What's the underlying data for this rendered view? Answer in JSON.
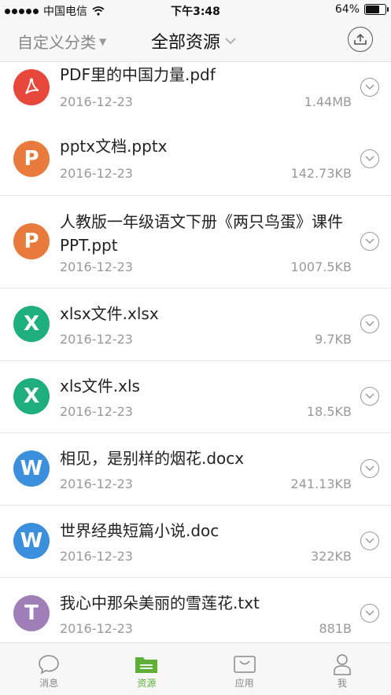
{
  "status_bar": {
    "carrier": "中国电信",
    "time": "下午3:48",
    "battery": "64%",
    "battery_level": 0.64
  },
  "header": {
    "left_label": "自定义分类",
    "center_label": "全部资源"
  },
  "files": [
    {
      "name": "PDF里的中国力量.pdf",
      "date": "2016-12-23",
      "size": "1.44MB",
      "icon": "pdf-icon",
      "color": "#e8483c"
    },
    {
      "name": "pptx文档.pptx",
      "date": "2016-12-23",
      "size": "142.73KB",
      "icon": "ppt-icon",
      "letter": "P",
      "color": "#e97a3d"
    },
    {
      "name": "人教版一年级语文下册《两只鸟蛋》课件PPT.ppt",
      "date": "2016-12-23",
      "size": "1007.5KB",
      "icon": "ppt-icon",
      "letter": "P",
      "color": "#e97a3d"
    },
    {
      "name": "xlsx文件.xlsx",
      "date": "2016-12-23",
      "size": "9.7KB",
      "icon": "excel-icon",
      "letter": "X",
      "color": "#1fae7e"
    },
    {
      "name": "xls文件.xls",
      "date": "2016-12-23",
      "size": "18.5KB",
      "icon": "excel-icon",
      "letter": "X",
      "color": "#1fae7e"
    },
    {
      "name": "相见，是别样的烟花.docx",
      "date": "2016-12-23",
      "size": "241.13KB",
      "icon": "word-icon",
      "letter": "W",
      "color": "#3b8fdc"
    },
    {
      "name": "世界经典短篇小说.doc",
      "date": "2016-12-23",
      "size": "322KB",
      "icon": "word-icon",
      "letter": "W",
      "color": "#3b8fdc"
    },
    {
      "name": "我心中那朵美丽的雪莲花.txt",
      "date": "2016-12-23",
      "size": "881B",
      "icon": "txt-icon",
      "letter": "T",
      "color": "#a07fb8"
    }
  ],
  "tabs": [
    {
      "label": "消息",
      "icon": "chat-icon",
      "active": false
    },
    {
      "label": "资源",
      "icon": "folder-icon",
      "active": true
    },
    {
      "label": "应用",
      "icon": "bag-icon",
      "active": false
    },
    {
      "label": "我",
      "icon": "user-icon",
      "active": false
    }
  ],
  "colors": {
    "accent": "#5fb037"
  }
}
